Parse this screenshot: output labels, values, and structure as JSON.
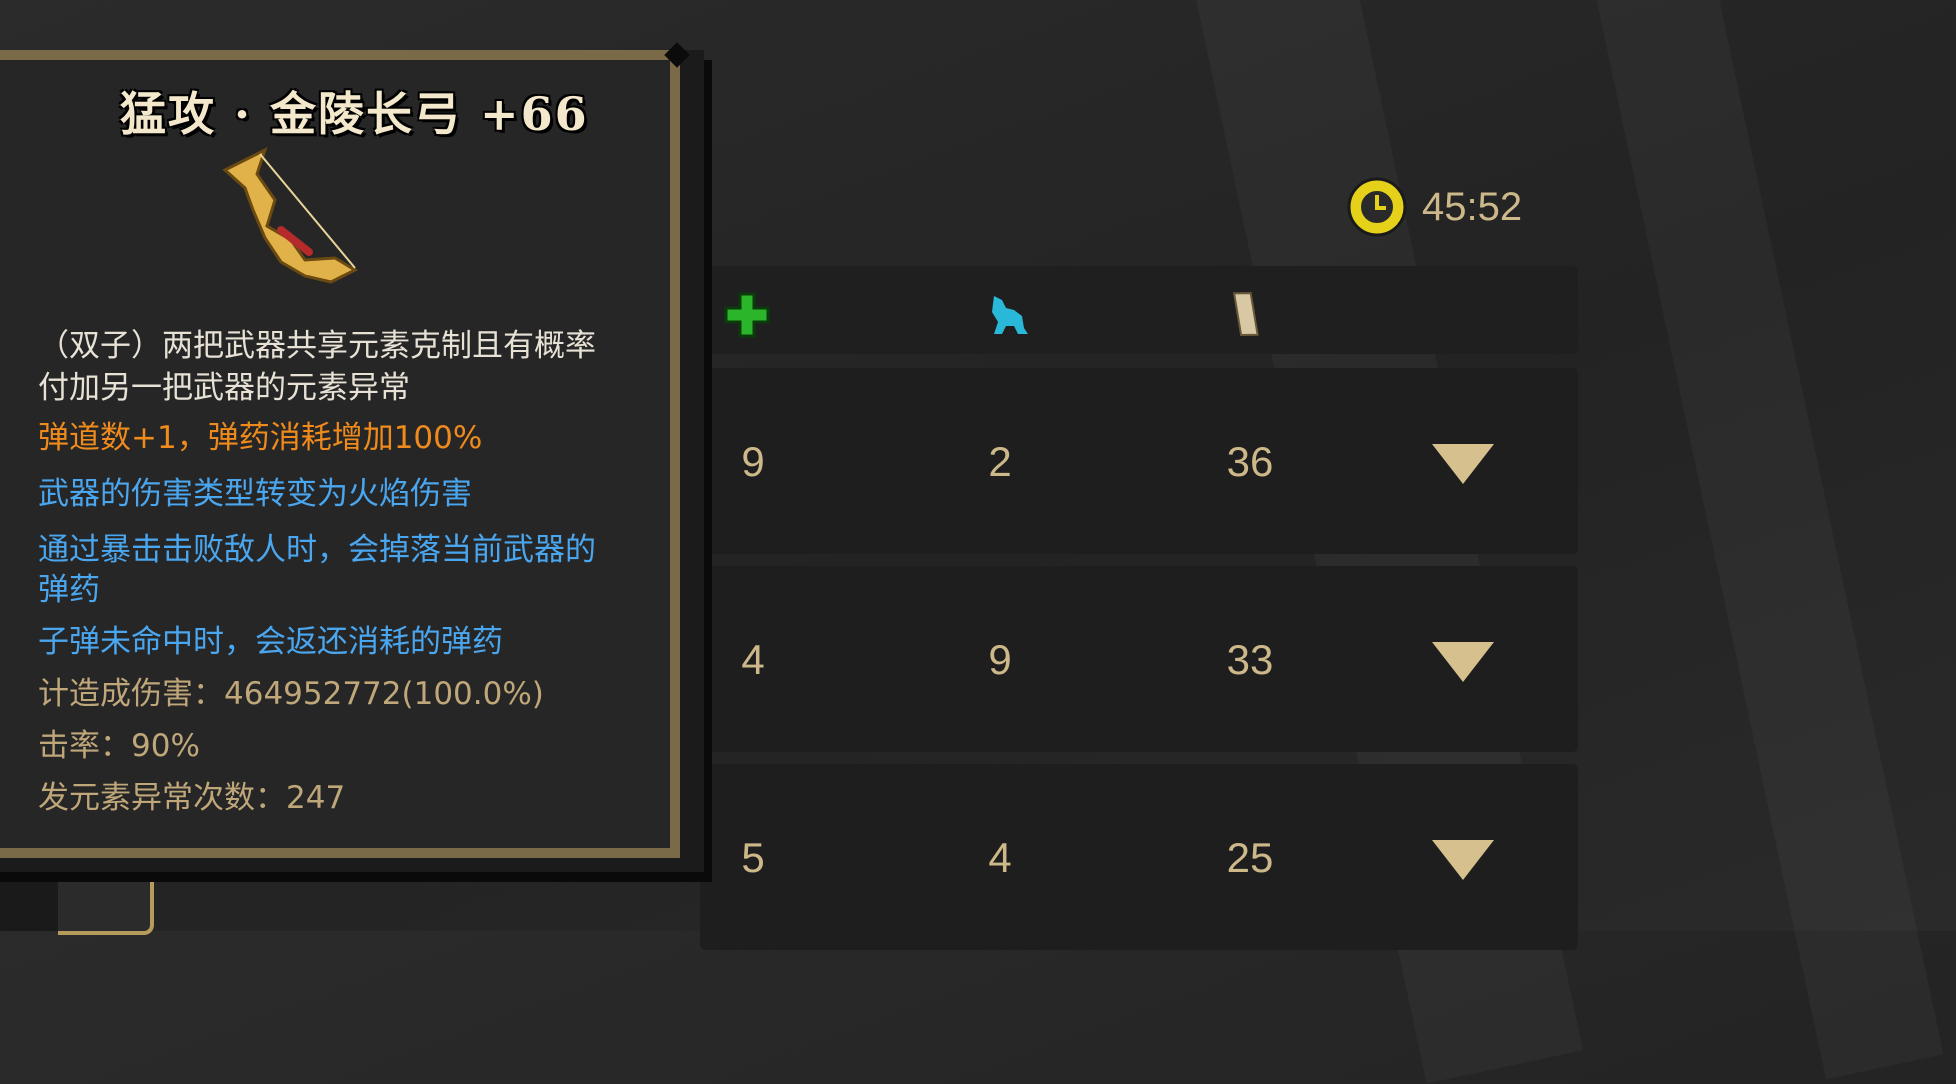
{
  "timer": {
    "value": "45:52",
    "icon": "clock-icon"
  },
  "header_icons": [
    "heal-cross-icon",
    "beast-icon",
    "scroll-icon"
  ],
  "rows": [
    {
      "c1": "9",
      "c2": "2",
      "c3": "36"
    },
    {
      "c1": "4",
      "c2": "9",
      "c3": "33"
    },
    {
      "c1": "5",
      "c2": "4",
      "c3": "25"
    }
  ],
  "tooltip": {
    "title": "猛攻 · 金陵长弓 +66",
    "lines": [
      "（双子）两把武器共享元素克制且有概率",
      "付加另一把武器的元素异常",
      "弹道数+1，弹药消耗增加100%",
      "武器的伤害类型转变为火焰伤害",
      "通过暴击击败敌人时，会掉落当前武器的",
      "弹药",
      "子弹未命中时，会返还消耗的弹药",
      "计造成伤害：464952772(100.0%)",
      "击率：90%",
      "发元素异常次数：247"
    ]
  },
  "colors": {
    "gold": "#cdb88a",
    "orange": "#ef8a1c",
    "blue": "#4aa6ef",
    "heal": "#2bb52b",
    "beast": "#29b8d8"
  }
}
